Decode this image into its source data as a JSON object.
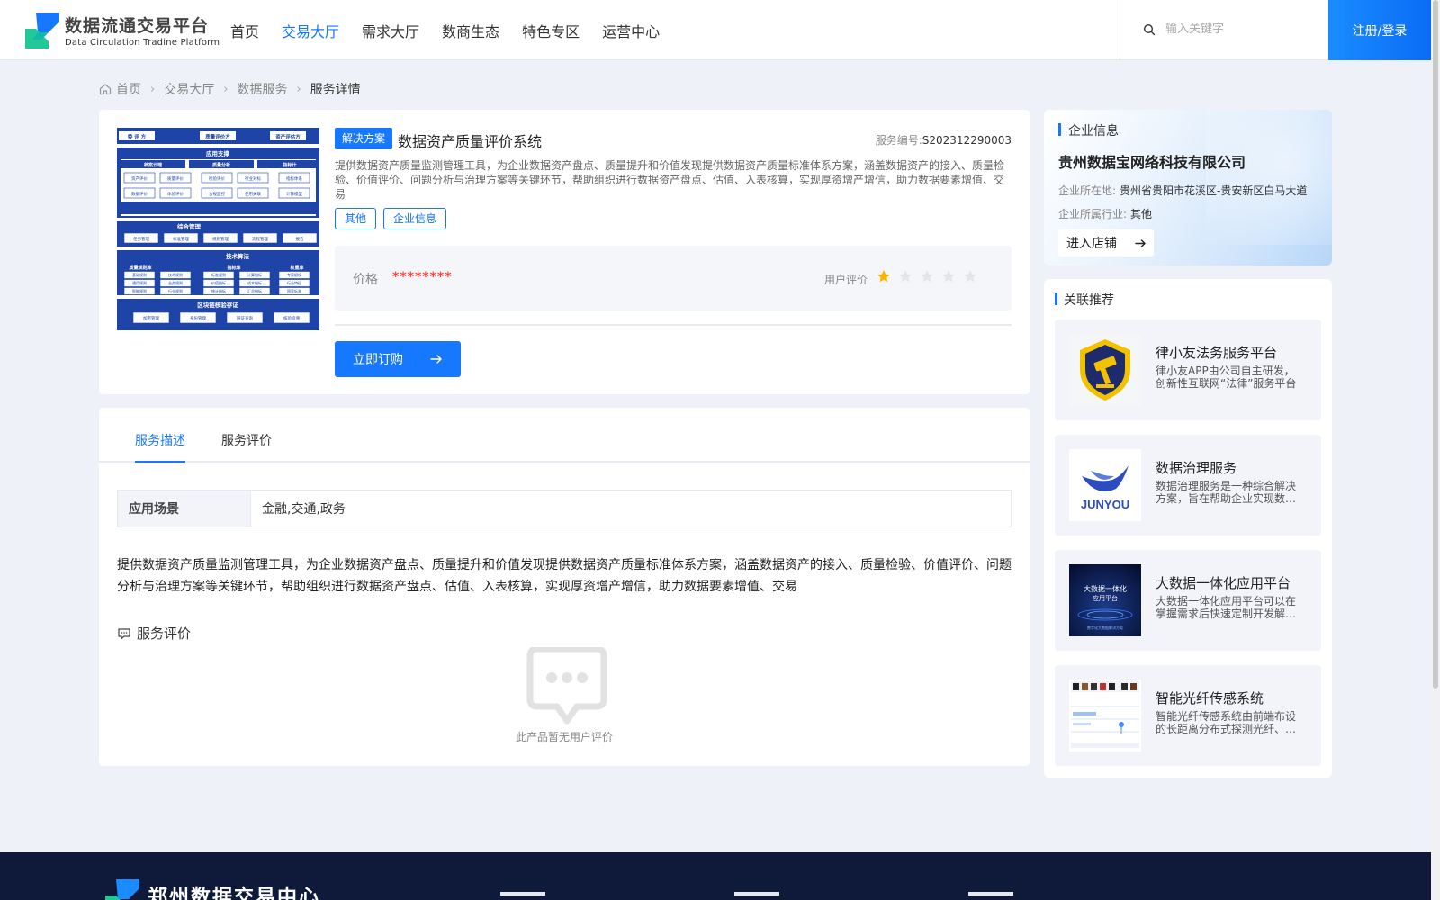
{
  "header": {
    "logo_title": "数据流通交易平台",
    "logo_subtitle": "Data Circulation Tradine Platform",
    "nav": [
      "首页",
      "交易大厅",
      "需求大厅",
      "数商生态",
      "特色专区",
      "运营中心"
    ],
    "nav_active_index": 1,
    "search_placeholder": "输入关键字",
    "login_label": "注册/登录"
  },
  "breadcrumb": [
    "首页",
    "交易大厅",
    "数据服务",
    "服务详情"
  ],
  "product": {
    "badge": "解决方案",
    "title": "数据资产质量评价系统",
    "service_no_label": "服务编号:",
    "service_no": "S202312290003",
    "description": "提供数据资产质量监测管理工具，为企业数据资产盘点、质量提升和价值发现提供数据资产质量标准体系方案，涵盖数据资产的接入、质量检验、价值评价、问题分析与治理方案等关键环节，帮助组织进行数据资产盘点、估值、入表核算，实现厚资增产增信，助力数据要素增值、交易",
    "tags": [
      "其他",
      "企业信息"
    ],
    "price_label": "价格",
    "price_value": "********",
    "rating_label": "用户评价",
    "rating": 1,
    "rating_max": 5,
    "buy_label": "立即订购",
    "diagram": {
      "top_labels": [
        "委 评 方",
        "质量评价方",
        "资产评估方"
      ],
      "section1": "应用支撑",
      "sub1": [
        "档案云端",
        "质量分析",
        "指标计"
      ],
      "row1a": [
        "资产评价",
        "质量评价",
        "检验评价",
        "行业对标",
        "指标体系"
      ],
      "row1b": [
        "数据评价",
        "体验评价",
        "合规监控",
        "使用关联",
        "计算模型"
      ],
      "section2": "综合管理",
      "row2": [
        "任务管理",
        "标准管理",
        "规则管理",
        "流程管理",
        "报告"
      ],
      "section3": "技术算法",
      "sub3": [
        "质量规则库",
        "指标库",
        "权重库"
      ],
      "row3a": [
        "基础规则",
        "技术规则",
        "标准规则",
        "计算指标",
        "专家赋权"
      ],
      "row3b": [
        "通用规则",
        "业务规则",
        "价值指标",
        "成本指标",
        "行业特征"
      ],
      "row3c": [
        "智能规则",
        "行业规则",
        "统计指标",
        "汇总指标",
        "国家标准"
      ],
      "section4": "区块链核验存证",
      "row4": [
        "加密管理",
        "身份管理",
        "链证查询",
        "核验追溯"
      ]
    }
  },
  "detail": {
    "tabs": [
      "服务描述",
      "服务评价"
    ],
    "active_tab": 0,
    "scene_label": "应用场景",
    "scene_value": "金融,交通,政务",
    "description": "提供数据资产质量监测管理工具，为企业数据资产盘点、质量提升和价值发现提供数据资产质量标准体系方案，涵盖数据资产的接入、质量检验、价值评价、问题分析与治理方案等关键环节，帮助组织进行数据资产盘点、估值、入表核算，实现厚资增产增信，助力数据要素增值、交易",
    "review_title": "服务评价",
    "empty_text": "此产品暂无用户评价"
  },
  "company": {
    "section_title": "企业信息",
    "name": "贵州数据宝网络科技有限公司",
    "location_label": "企业所在地:",
    "location": "贵州省贵阳市花溪区-贵安新区白马大道",
    "industry_label": "企业所属行业:",
    "industry": "其他",
    "enter_label": "进入店铺"
  },
  "recommend": {
    "section_title": "关联推荐",
    "items": [
      {
        "title": "律小友法务服务平台",
        "desc": "律小友APP由公司自主研发，创新性互联网“法律”服务平台"
      },
      {
        "title": "数据治理服务",
        "desc": "数据治理服务是一种综合解决方案，旨在帮助企业实现数据的高效管理"
      },
      {
        "title": "大数据一体化应用平台",
        "desc": "大数据一体化应用平台可以在掌握需求后快速定制开发解决方案"
      },
      {
        "title": "智能光纤传感系统",
        "desc": "智能光纤传感系统由前端布设的长距离分布式探测光纤、后端解调设备组成"
      }
    ],
    "thumb_texts": {
      "junyou": "JUNYOU",
      "bigdata_line1": "大数据一体化",
      "bigdata_line2": "应用平台",
      "bigdata_sub": "数字化大数据解决方案"
    }
  },
  "footer": {
    "title": "郑州数据交易中心"
  },
  "colors": {
    "primary": "#1677ff",
    "price": "#ff3b30",
    "star_active": "#f7b500",
    "star_inactive": "#e5e5e5",
    "footer_bg": "#0f1a3a"
  }
}
